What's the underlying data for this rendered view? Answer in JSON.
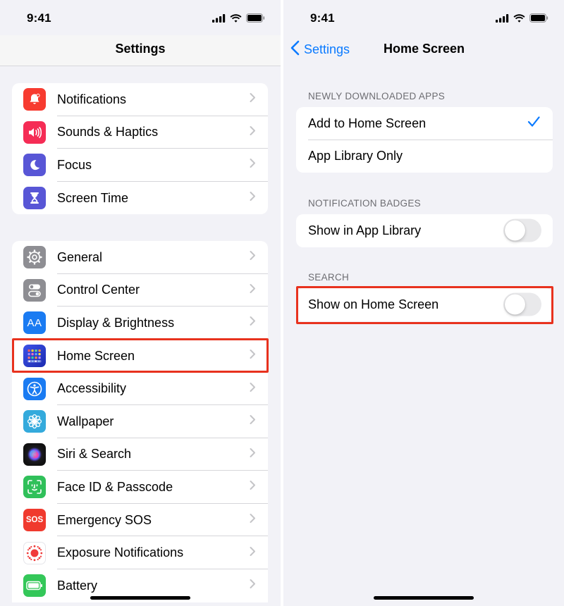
{
  "left": {
    "status_time": "9:41",
    "nav_title": "Settings",
    "groups": [
      [
        {
          "label": "Notifications",
          "icon": "bell-icon",
          "color": "#f73b30"
        },
        {
          "label": "Sounds & Haptics",
          "icon": "speaker-icon",
          "color": "#f52c55"
        },
        {
          "label": "Focus",
          "icon": "moon-icon",
          "color": "#5856d6"
        },
        {
          "label": "Screen Time",
          "icon": "hourglass-icon",
          "color": "#5856d6"
        }
      ],
      [
        {
          "label": "General",
          "icon": "gear-icon",
          "color": "#8e8e93"
        },
        {
          "label": "Control Center",
          "icon": "switches-icon",
          "color": "#8e8e93"
        },
        {
          "label": "Display & Brightness",
          "icon": "text-size-icon",
          "color": "#1a7bf2"
        },
        {
          "label": "Home Screen",
          "icon": "app-grid-icon",
          "color": "#2a3fd8"
        },
        {
          "label": "Accessibility",
          "icon": "accessibility-icon",
          "color": "#1a7bf2"
        },
        {
          "label": "Wallpaper",
          "icon": "flower-icon",
          "color": "#34aadc"
        },
        {
          "label": "Siri & Search",
          "icon": "siri-icon",
          "color": "#1c1c1e"
        },
        {
          "label": "Face ID & Passcode",
          "icon": "face-id-icon",
          "color": "#30c05a"
        },
        {
          "label": "Emergency SOS",
          "icon": "sos-icon",
          "color": "#f03a2e"
        },
        {
          "label": "Exposure Notifications",
          "icon": "exposure-icon",
          "color": "#ffffff"
        },
        {
          "label": "Battery",
          "icon": "battery-icon",
          "color": "#34c759"
        }
      ]
    ],
    "sos_text": "SOS",
    "display_icon_text": "AA"
  },
  "right": {
    "status_time": "9:41",
    "back_label": "Settings",
    "nav_title": "Home Screen",
    "sections": [
      {
        "header": "NEWLY DOWNLOADED APPS",
        "rows": [
          {
            "label": "Add to Home Screen",
            "checked": true
          },
          {
            "label": "App Library Only",
            "checked": false
          }
        ]
      },
      {
        "header": "NOTIFICATION BADGES",
        "rows": [
          {
            "label": "Show in App Library",
            "toggle": false
          }
        ]
      },
      {
        "header": "SEARCH",
        "rows": [
          {
            "label": "Show on Home Screen",
            "toggle": false
          }
        ]
      }
    ]
  },
  "colors": {
    "accent": "#0a7aff",
    "highlight": "#e8321e",
    "background": "#f2f2f7"
  }
}
